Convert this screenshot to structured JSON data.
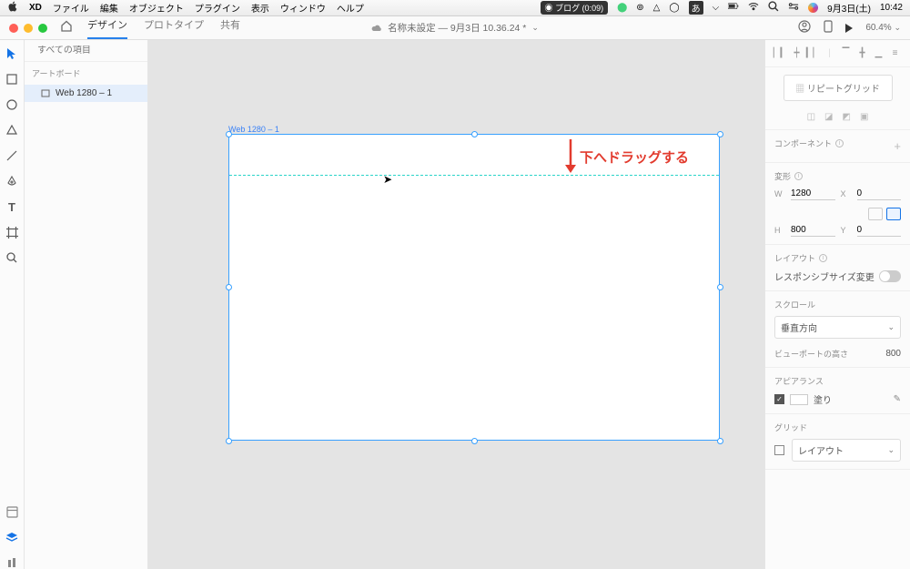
{
  "menubar": {
    "app": "XD",
    "items": [
      "ファイル",
      "編集",
      "オブジェクト",
      "プラグイン",
      "表示",
      "ウィンドウ",
      "ヘルプ"
    ],
    "blog": "ブログ (0:09)",
    "ime": "あ",
    "date": "9月3日(土)",
    "time": "10:42"
  },
  "header": {
    "tabs": [
      "デザイン",
      "プロトタイプ",
      "共有"
    ],
    "active_tab": 0,
    "doc_title": "名称未設定 — 9月3日 10.36.24 *",
    "zoom": "60.4%"
  },
  "leftpanel": {
    "search_placeholder": "すべての項目",
    "section": "アートボード",
    "layer": "Web 1280 – 1"
  },
  "canvas": {
    "artboard_label": "Web 1280 – 1",
    "annotation": "下へドラッグする"
  },
  "right": {
    "repeat_grid": "リピートグリッド",
    "component": "コンポーネント",
    "transform": "変形",
    "w": "1280",
    "h": "800",
    "x": "0",
    "y": "0",
    "layout": "レイアウト",
    "responsive": "レスポンシブサイズ変更",
    "scroll": "スクロール",
    "scroll_value": "垂直方向",
    "viewport_h_label": "ビューポートの高さ",
    "viewport_h": "800",
    "appearance": "アピアランス",
    "fill": "塗り",
    "grid": "グリッド",
    "grid_value": "レイアウト"
  },
  "labels": {
    "W": "W",
    "H": "H",
    "X": "X",
    "Y": "Y"
  }
}
